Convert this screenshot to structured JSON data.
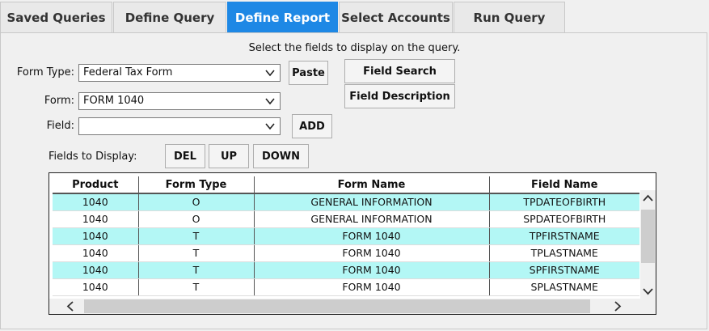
{
  "tabs": [
    {
      "label": "Saved Queries",
      "active": false
    },
    {
      "label": "Define Query",
      "active": false
    },
    {
      "label": "Define Report",
      "active": true
    },
    {
      "label": "Select Accounts",
      "active": false
    },
    {
      "label": "Run Query",
      "active": false
    }
  ],
  "instruction": "Select the fields to display on the query.",
  "form": {
    "form_type_label": "Form Type:",
    "form_type_value": "Federal Tax Form",
    "form_label": "Form:",
    "form_value": "FORM 1040",
    "field_label": "Field:",
    "field_value": "",
    "paste_label": "Paste",
    "add_label": "ADD",
    "field_search_label": "Field Search",
    "field_description_label": "Field Description",
    "fields_to_display_label": "Fields to Display:",
    "del_label": "DEL",
    "up_label": "UP",
    "down_label": "DOWN"
  },
  "grid": {
    "columns": [
      "Product",
      "Form Type",
      "Form Name",
      "Field Name"
    ],
    "rows": [
      [
        "1040",
        "O",
        "GENERAL INFORMATION",
        "TPDATEOFBIRTH"
      ],
      [
        "1040",
        "O",
        "GENERAL INFORMATION",
        "SPDATEOFBIRTH"
      ],
      [
        "1040",
        "T",
        "FORM 1040",
        "TPFIRSTNAME"
      ],
      [
        "1040",
        "T",
        "FORM 1040",
        "TPLASTNAME"
      ],
      [
        "1040",
        "T",
        "FORM 1040",
        "SPFIRSTNAME"
      ],
      [
        "1040",
        "T",
        "FORM 1040",
        "SPLASTNAME"
      ]
    ]
  },
  "colors": {
    "accent": "#1e88e5",
    "row_highlight": "#b3f7f5"
  },
  "icons": {
    "select_arrow": "chevron-down-icon",
    "scroll_up": "chevron-up-icon",
    "scroll_down": "chevron-down-icon",
    "scroll_left": "chevron-left-icon",
    "scroll_right": "chevron-right-icon"
  }
}
